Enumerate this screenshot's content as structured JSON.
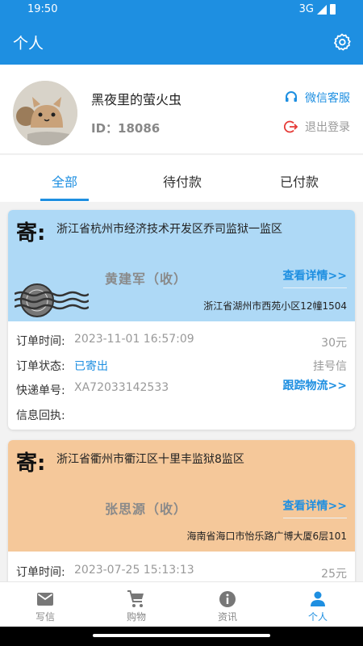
{
  "status_bar": {
    "time": "19:50",
    "network": "3G"
  },
  "app_bar": {
    "title": "个人"
  },
  "profile": {
    "nickname": "黑夜里的萤火虫",
    "id_text": "ID：18086",
    "wechat_service": "微信客服",
    "logout": "退出登录"
  },
  "tabs": [
    {
      "label": "全部",
      "active": true
    },
    {
      "label": "待付款",
      "active": false
    },
    {
      "label": "已付款",
      "active": false
    }
  ],
  "labels": {
    "ji": "寄:",
    "view_detail": "查看详情>>",
    "order_time": "订单时间:",
    "order_status": "订单状态:",
    "tracking_no": "快递单号:",
    "receipt": "信息回执:"
  },
  "orders": [
    {
      "to_address": "浙江省杭州市经济技术开发区乔司监狱一监区",
      "recipient": "黄建军（收）",
      "from_address": "浙江省湖州市西苑小区12幢1504",
      "order_time": "2023-11-01 16:57:09",
      "price": "30元",
      "status": "已寄出",
      "mail_type": "挂号信",
      "tracking_no": "XA72033142533",
      "track_link": "跟踪物流>>",
      "receipt": ""
    },
    {
      "to_address": "浙江省衢州市衢江区十里丰监狱8监区",
      "recipient": "张思源（收）",
      "from_address": "海南省海口市怡乐路广博大厦6层101",
      "order_time": "2023-07-25 15:13:13",
      "price": "25元"
    }
  ],
  "bottom_nav": [
    {
      "label": "写信",
      "icon": "mail-icon",
      "active": false
    },
    {
      "label": "购物",
      "icon": "cart-icon",
      "active": false
    },
    {
      "label": "资讯",
      "icon": "info-icon",
      "active": false
    },
    {
      "label": "个人",
      "icon": "person-icon",
      "active": true
    }
  ],
  "colors": {
    "primary": "#1e8fe1",
    "card_blue": "#aed9f6",
    "card_orange": "#f5c89a"
  }
}
